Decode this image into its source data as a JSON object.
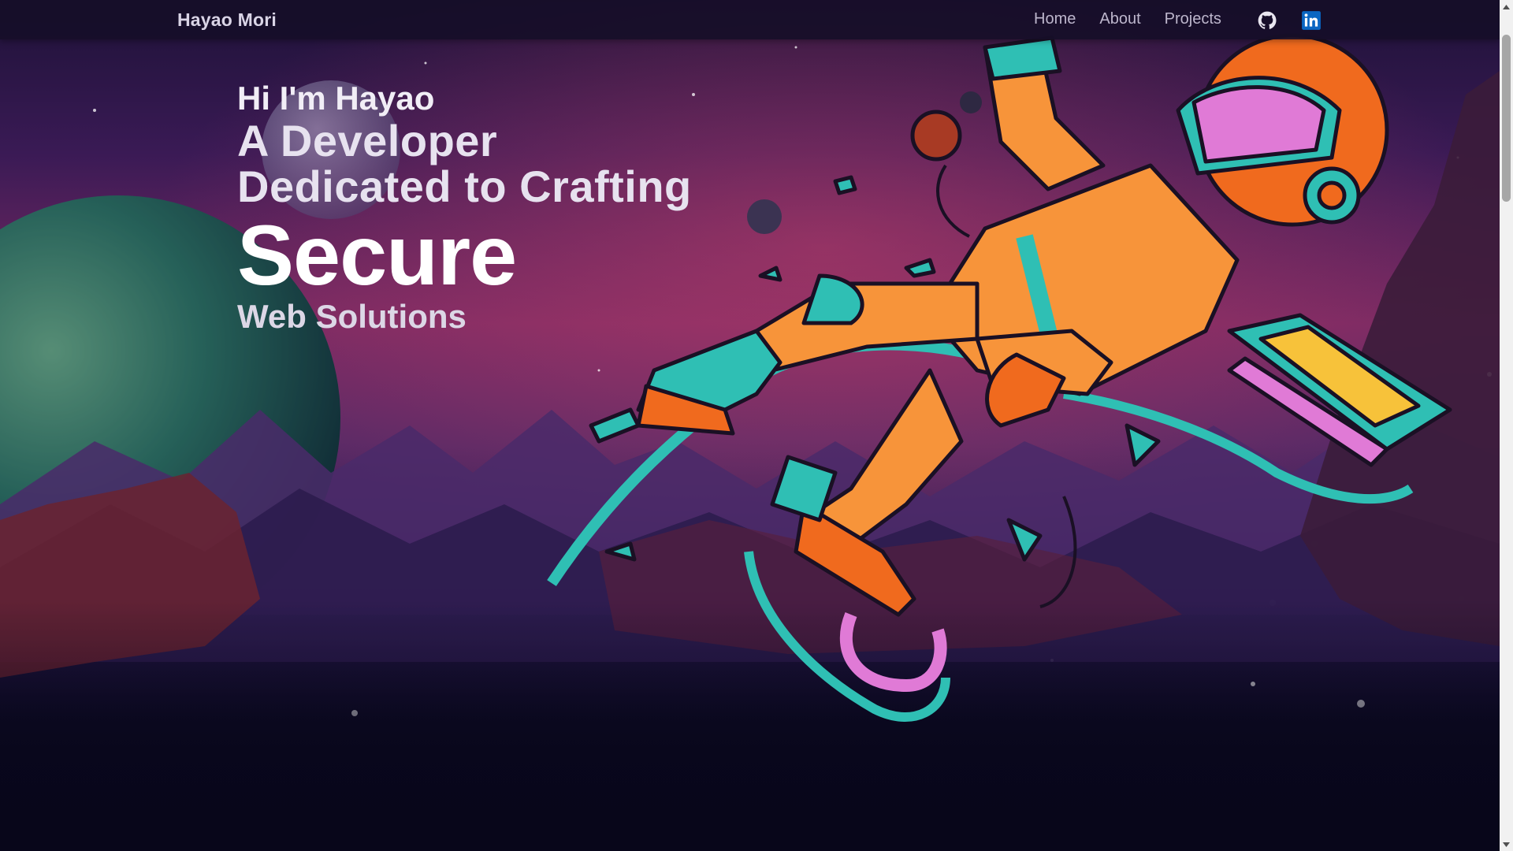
{
  "navbar": {
    "brand": "Hayao Mori",
    "links": [
      {
        "label": "Home"
      },
      {
        "label": "About"
      },
      {
        "label": "Projects"
      }
    ],
    "icons": [
      "github-icon",
      "linkedin-icon"
    ]
  },
  "hero": {
    "greeting": "Hi I'm Hayao",
    "line1": "A Developer",
    "line2": "Dedicated to Crafting",
    "highlight": "Secure",
    "tail": "Web Solutions"
  },
  "colors": {
    "page_bg": "#08061a",
    "nav_bg": "#160e28",
    "sky_top": "#2a1446",
    "sky_mid": "#8a2f6c",
    "suit_orange": "#f7943a",
    "suit_teal": "#2fbfb4",
    "linkedin_blue": "#0a66c2"
  }
}
